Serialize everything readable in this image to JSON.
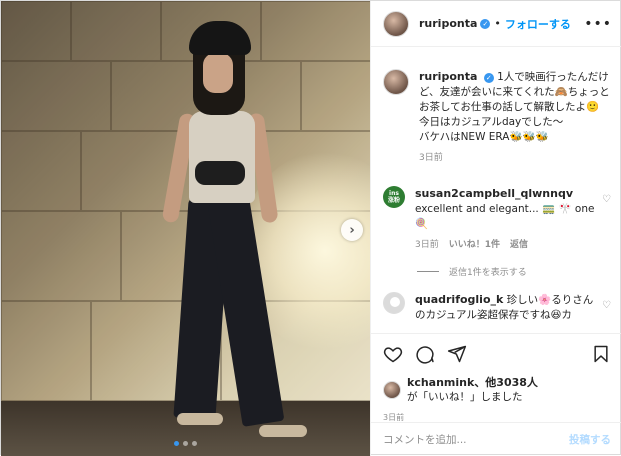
{
  "header": {
    "username": "ruriponta",
    "separator": "•",
    "follow_label": "フォローする",
    "more_label": "•••"
  },
  "post": {
    "username": "ruriponta",
    "caption": "1人で映画行ったんだけど、友達が会いに来てくれた🙈ちょっとお茶してお仕事の話して解散したよ🙂\n今日はカジュアルdayでした～\nバケハはNEW ERA🐝🐝🐝",
    "time": "3日前"
  },
  "comments": [
    {
      "username": "susan2campbell_qlwnnqv",
      "text": "excellent and elegant... 🚃 🎌 one 🍭",
      "time": "3日前",
      "likes_label": "いいね！1件",
      "reply_label": "返信",
      "avatar_text_top": "ins",
      "avatar_text_bottom": "涨粉",
      "view_replies": "返信1件を表示する"
    },
    {
      "username": "quadrifoglio_k",
      "text": "珍しい🌸るりさんのカジュアル姿超保存ですね😆カ"
    }
  ],
  "likes": {
    "user": "kchanmink",
    "rest": "、他3038人",
    "suffix": "が「いいね！」しました"
  },
  "post_time": "3日前",
  "add_comment": {
    "placeholder": "コメントを追加...",
    "post_label": "投稿する"
  },
  "carousel": {
    "count": 3,
    "active_index": 0,
    "next_label": "›"
  },
  "colors": {
    "accent": "#0095f6",
    "verified": "#3897f0",
    "muted": "#8e8e8e"
  }
}
